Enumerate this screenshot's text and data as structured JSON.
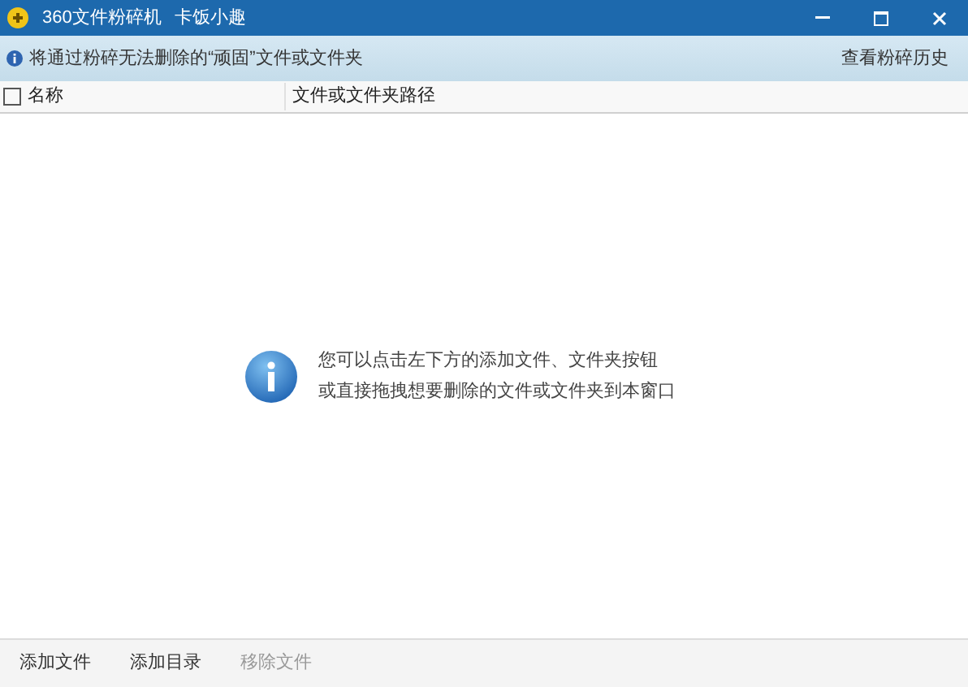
{
  "window": {
    "title": "360文件粉碎机",
    "subtitle": "卡饭小趣"
  },
  "info_bar": {
    "text": "将通过粉碎无法删除的“顽固”文件或文件夹",
    "link": "查看粉碎历史"
  },
  "table": {
    "select_all_checked": false,
    "columns": [
      "名称",
      "文件或文件夹路径"
    ]
  },
  "empty_hint": {
    "lines": [
      "您可以点击左下方的添加文件、文件夹按钮",
      "或直接拖拽想要删除的文件或文件夹到本窗口"
    ]
  },
  "footer_buttons": [
    {
      "label": "添加文件",
      "disabled": false
    },
    {
      "label": "添加目录",
      "disabled": false
    },
    {
      "label": "移除文件",
      "disabled": true
    }
  ]
}
